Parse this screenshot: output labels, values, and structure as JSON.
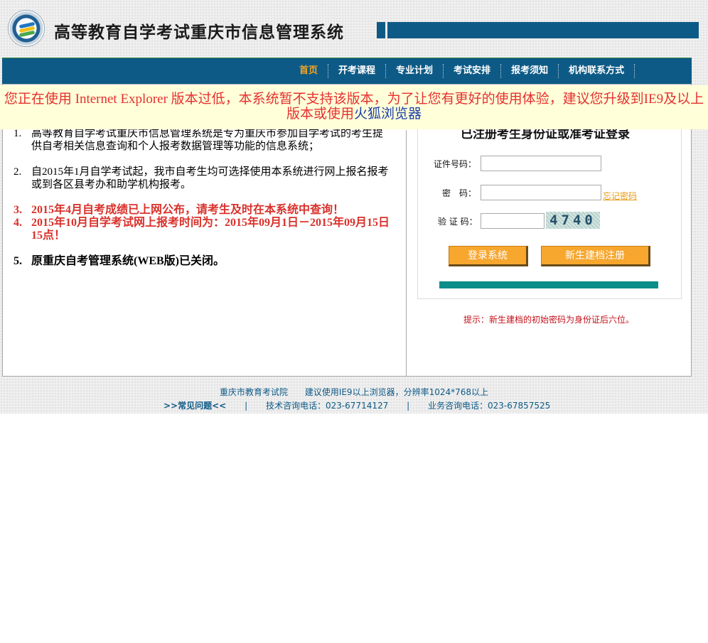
{
  "header": {
    "title": "高等教育自学考试重庆市信息管理系统"
  },
  "nav": {
    "items": [
      {
        "label": "首页"
      },
      {
        "label": "开考课程"
      },
      {
        "label": "专业计划"
      },
      {
        "label": "考试安排"
      },
      {
        "label": "报考须知"
      },
      {
        "label": "机构联系方式"
      }
    ]
  },
  "banner": {
    "text1": "您正在使用  Internet Explorer 版本过低，本系统暂不支持该版本，为了让您有更好的使用体验，建议您升级到IE9及以上版本或使用",
    "link": "火狐浏览器"
  },
  "notices": [
    {
      "num": "1.",
      "text": "高等教育自学考试重庆市信息管理系统是专为重庆市参加自学考试的考生提供自考相关信息查询和个人报考数据管理等功能的信息系统；"
    },
    {
      "num": "2.",
      "text": "自2015年1月自学考试起，我市自考生均可选择使用本系统进行网上报名报考或到各区县考办和助学机构报考。"
    },
    {
      "num": "3.",
      "text": "2015年4月自考成绩已上网公布，请考生及时在本系统中查询！"
    },
    {
      "num": "4.",
      "text": "2015年10月自学考试网上报考时间为：2015年09月1日－2015年09月15日15点！"
    },
    {
      "num": "5.",
      "text": "原重庆自考管理系统(WEB版)已关闭。"
    }
  ],
  "login": {
    "title": "已注册考生身份证或准考证登录",
    "id_label": "证件号码：",
    "password_label": "密　码：",
    "captcha_label": "验 证 码：",
    "id_value": "",
    "password_value": "",
    "captcha_value": "",
    "forgot": "忘记密码",
    "captcha_text": "4740",
    "login_button": "登录系统",
    "register_button": "新生建档注册"
  },
  "hint": "提示：新生建档的初始密码为身份证后六位。",
  "footer": {
    "org": "重庆市教育考试院",
    "browser_tip": "建议使用IE9以上浏览器，分辨率1024*768以上",
    "faq": ">>常见问题<<",
    "sep": "|",
    "tech_phone": "技术咨询电话：023-67714127",
    "biz_phone": "业务咨询电话：023-67857525"
  },
  "colors": {
    "nav_bg": "#0d5a86",
    "active_nav": "#f5a623",
    "button": "#f7a62e",
    "teal": "#0b8d89",
    "warning_text": "#e53030"
  }
}
